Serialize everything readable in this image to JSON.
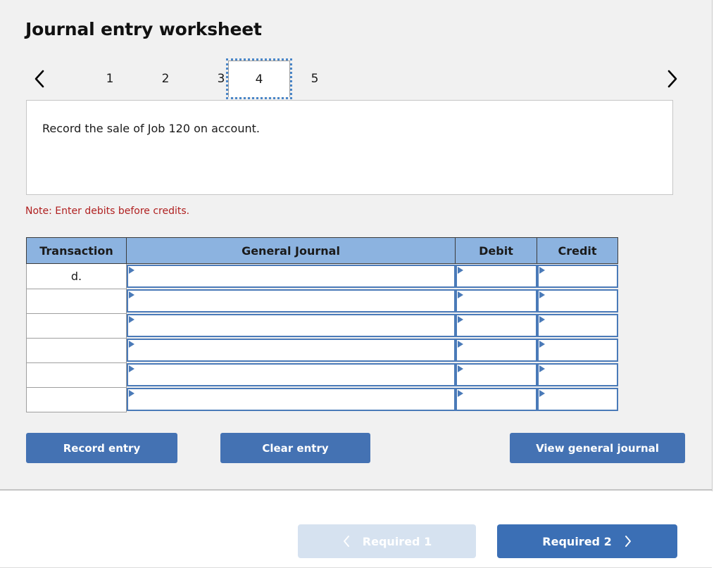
{
  "header": {
    "title": "Journal entry worksheet"
  },
  "tabs": {
    "prev_icon": "chevron-left-icon",
    "next_icon": "chevron-right-icon",
    "items": [
      {
        "label": "1",
        "active": false
      },
      {
        "label": "2",
        "active": false
      },
      {
        "label": "3",
        "active": false
      },
      {
        "label": "4",
        "active": true
      },
      {
        "label": "5",
        "active": false
      }
    ]
  },
  "description": {
    "text": "Record the sale of Job 120 on account."
  },
  "note": {
    "text": "Note: Enter debits before credits."
  },
  "journal_table": {
    "columns": [
      "Transaction",
      "General Journal",
      "Debit",
      "Credit"
    ],
    "rows": [
      {
        "transaction": "d.",
        "general_journal": "",
        "debit": "",
        "credit": ""
      },
      {
        "transaction": "",
        "general_journal": "",
        "debit": "",
        "credit": ""
      },
      {
        "transaction": "",
        "general_journal": "",
        "debit": "",
        "credit": ""
      },
      {
        "transaction": "",
        "general_journal": "",
        "debit": "",
        "credit": ""
      },
      {
        "transaction": "",
        "general_journal": "",
        "debit": "",
        "credit": ""
      },
      {
        "transaction": "",
        "general_journal": "",
        "debit": "",
        "credit": ""
      }
    ]
  },
  "actions": {
    "record_entry": "Record entry",
    "clear_entry": "Clear entry",
    "view_general_journal": "View general journal"
  },
  "bottom_nav": {
    "prev_label": "Required 1",
    "prev_icon": "chevron-left-icon",
    "prev_disabled": true,
    "next_label": "Required 2",
    "next_icon": "chevron-right-icon"
  },
  "colors": {
    "panel_background": "#f1f1f1",
    "table_header_blue": "#8cb3e0",
    "input_border_blue": "#4a7ab8",
    "button_blue": "#4472b3",
    "nav_active_blue": "#3b6fb5",
    "nav_disabled_blue": "#d6e2f0",
    "note_red": "#b02020",
    "focus_outline_blue": "#4a86c8"
  }
}
